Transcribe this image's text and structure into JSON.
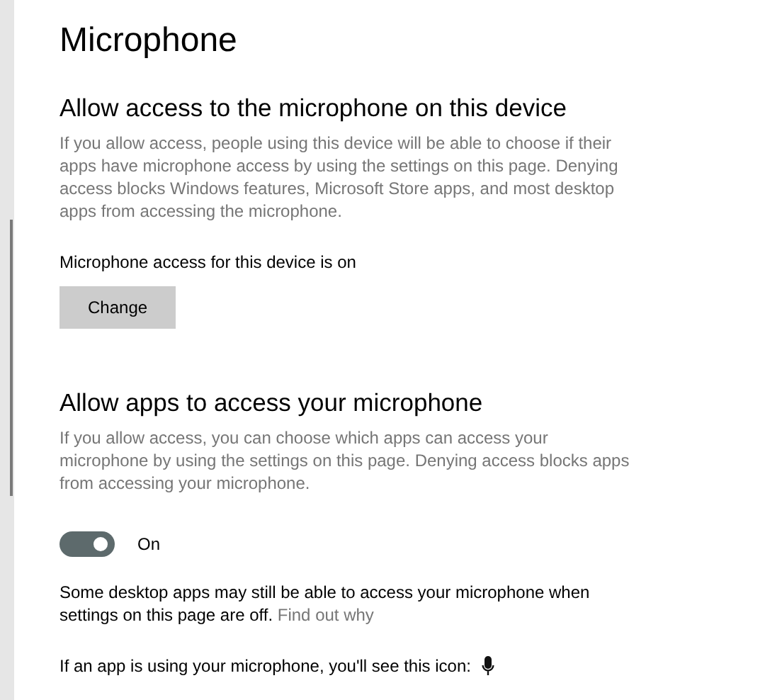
{
  "title": "Microphone",
  "device_section": {
    "heading": "Allow access to the microphone on this device",
    "description": "If you allow access, people using this device will be able to choose if their apps have microphone access by using the settings on this page. Denying access blocks Windows features, Microsoft Store apps, and most desktop apps from accessing the microphone.",
    "status": "Microphone access for this device is on",
    "button": "Change"
  },
  "apps_section": {
    "heading": "Allow apps to access your microphone",
    "description": "If you allow access, you can choose which apps can access your microphone by using the settings on this page. Denying access blocks apps from accessing your microphone.",
    "toggle": {
      "on": true,
      "label": "On"
    },
    "note": "Some desktop apps may still be able to access your microphone when settings on this page are off.",
    "link": "Find out why",
    "icon_note": "If an app is using your microphone, you'll see this icon:"
  }
}
